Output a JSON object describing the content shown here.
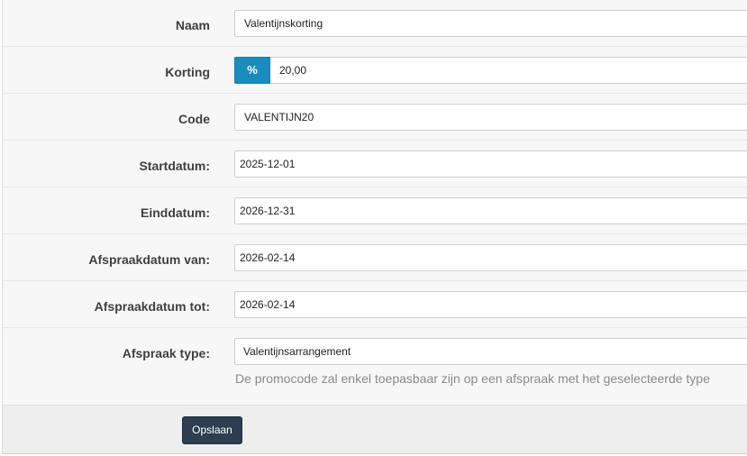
{
  "form": {
    "name": {
      "label": "Naam",
      "value": "Valentijnskorting"
    },
    "discount": {
      "label": "Korting",
      "unit": "%",
      "value": "20,00"
    },
    "code": {
      "label": "Code",
      "value": "VALENTIJN20"
    },
    "start_date": {
      "label": "Startdatum:",
      "value": "2025-12-01"
    },
    "end_date": {
      "label": "Einddatum:",
      "value": "2026-12-31"
    },
    "appointment_from": {
      "label": "Afspraakdatum van:",
      "value": "2026-02-14"
    },
    "appointment_to": {
      "label": "Afspraakdatum tot:",
      "value": "2026-02-14"
    },
    "appointment_type": {
      "label": "Afspraak type:",
      "value": "Valentijnsarrangement",
      "help": "De promocode zal enkel toepasbaar zijn op een afspraak met het geselecteerde type"
    }
  },
  "footer": {
    "save_label": "Opslaan"
  },
  "colors": {
    "accent": "#1a8bbd",
    "button": "#2c3e50"
  }
}
